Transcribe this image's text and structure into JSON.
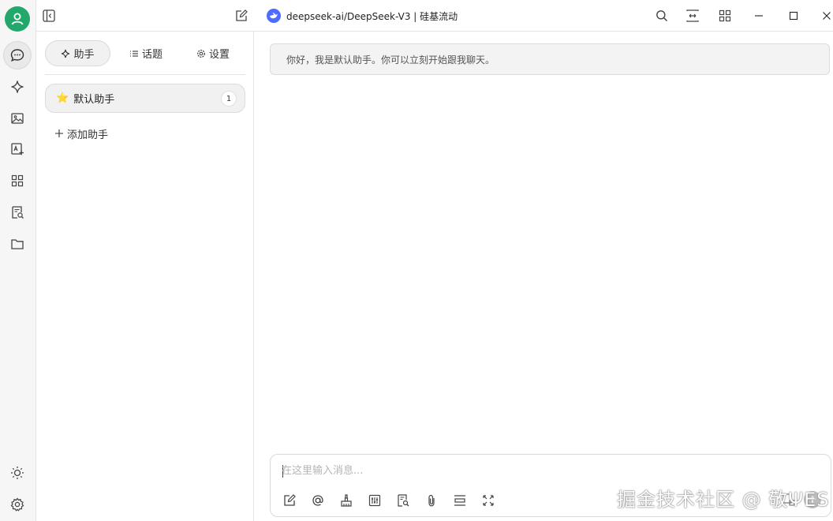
{
  "topbar": {
    "model_title": "deepseek-ai/DeepSeek-V3 | 硅基流动"
  },
  "rail": {
    "items": [
      {
        "name": "chat-icon",
        "active": true
      },
      {
        "name": "sparkle-icon"
      },
      {
        "name": "image-icon"
      },
      {
        "name": "image-translate-icon"
      },
      {
        "name": "apps-icon"
      },
      {
        "name": "knowledge-icon"
      },
      {
        "name": "folder-icon"
      }
    ],
    "bottom": [
      {
        "name": "sun-icon"
      },
      {
        "name": "settings-icon"
      }
    ]
  },
  "panel": {
    "tabs": [
      {
        "label": "助手",
        "icon": "sparkle-icon",
        "active": true
      },
      {
        "label": "话题",
        "icon": "list-icon"
      },
      {
        "label": "设置",
        "icon": "gear-icon"
      }
    ],
    "assistant": {
      "emoji": "⭐",
      "name": "默认助手",
      "count": "1"
    },
    "add_label": "添加助手"
  },
  "chat": {
    "greeting": "你好，我是默认助手。你可以立刻开始跟我聊天。"
  },
  "input": {
    "placeholder": "在这里输入消息...",
    "value": "",
    "tools": [
      "new-topic-icon",
      "mention-icon",
      "clear-icon",
      "settings-sliders-icon",
      "knowledge-search-icon",
      "attachment-icon",
      "line-icon",
      "expand-icon"
    ]
  },
  "watermark": "掘金技术社区 @ 敬ΨES",
  "colors": {
    "avatar": "#22a86a",
    "model_logo": "#4d6bfe",
    "send": "#bdbdbd"
  }
}
